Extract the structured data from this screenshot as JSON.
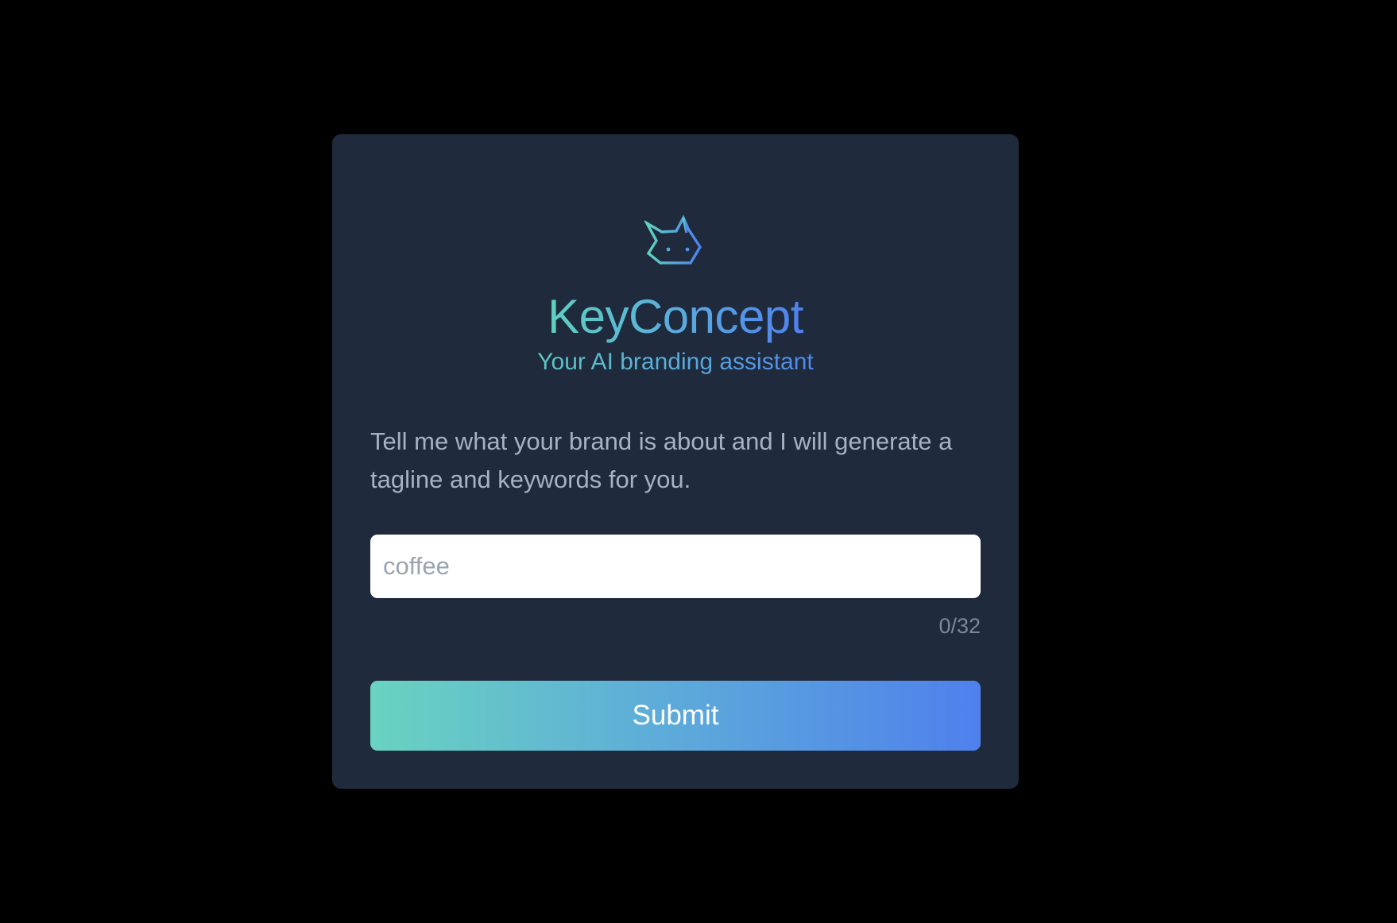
{
  "brand": {
    "logo_icon": "cat-head-icon",
    "name": "KeyConcept",
    "tagline": "Your AI branding assistant"
  },
  "form": {
    "description": "Tell me what your brand is about and I will generate a tagline and keywords for you.",
    "input": {
      "value": "",
      "placeholder": "coffee"
    },
    "char_counter": "0/32",
    "submit_label": "Submit"
  },
  "colors": {
    "page_background": "#000000",
    "card_background": "#1f2a3c",
    "gradient_start": "#69d3c0",
    "gradient_end": "#4f80ec",
    "description_text": "#a7b1c2",
    "counter_text": "#7d8797"
  }
}
